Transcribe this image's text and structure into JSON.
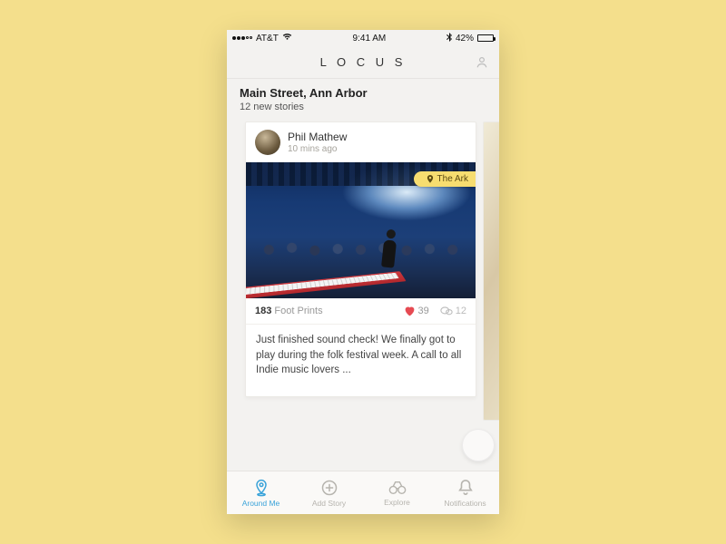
{
  "statusbar": {
    "carrier": "AT&T",
    "time": "9:41 AM",
    "battery_pct": "42%"
  },
  "app": {
    "title": "L O C U S"
  },
  "location": {
    "title": "Main Street, Ann Arbor",
    "subtitle": "12 new stories"
  },
  "card": {
    "author": "Phil Mathew",
    "time": "10 mins ago",
    "venue_tag": "The Ark",
    "footprints_count": "183",
    "footprints_label": "Foot Prints",
    "likes": "39",
    "comments": "12",
    "caption": "Just finished sound check! We finally got to play during the folk festival week. A call to all Indie music lovers ..."
  },
  "tabs": {
    "around": "Around Me",
    "add": "Add Story",
    "explore": "Explore",
    "notifications": "Notifications"
  },
  "icons": {
    "profile": "profile-icon",
    "pin": "pin-icon",
    "heart": "heart-icon",
    "comment": "comment-icon",
    "around": "around-me-icon",
    "add": "add-story-icon",
    "explore": "explore-icon",
    "bell": "notifications-icon"
  }
}
